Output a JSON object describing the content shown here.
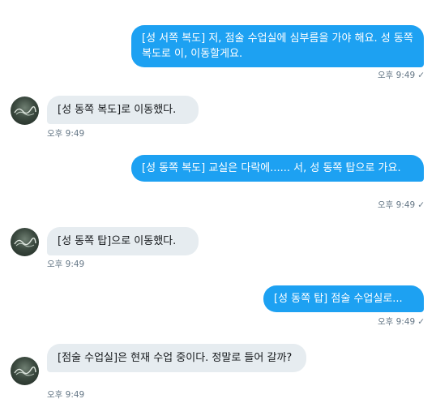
{
  "conversation": {
    "messages": [
      {
        "from": "me",
        "text": "[성 서쪽 복도] 저, 점술 수업실에 심부름을 가야 해요. 성 동쪽 복도로 이, 이동할게요.",
        "time": "오후 9:49",
        "status_icon": "check-icon"
      },
      {
        "from": "bot",
        "text": "[성 동쪽 복도]로 이동했다.",
        "time": "오후 9:49"
      },
      {
        "from": "me",
        "text": "[성 동쪽 복도] 교실은 다락에...... 서, 성 동쪽 탑으로 가요.",
        "time": "오후 9:49",
        "status_icon": "check-icon"
      },
      {
        "from": "bot",
        "text": "[성 동쪽 탑]으로 이동했다.",
        "time": "오후 9:49"
      },
      {
        "from": "me",
        "text": "[성 동쪽 탑] 점술 수업실로...",
        "time": "오후 9:49",
        "status_icon": "check-icon"
      },
      {
        "from": "bot",
        "text": "[점술 수업실]은 현재 수업 중이다. 정말로 들어 갈까?",
        "time": "오후 9:49"
      }
    ]
  },
  "theme": {
    "outgoing_bubble": "#1da1f2",
    "incoming_bubble": "#e6ecf0",
    "meta_text": "#657786"
  }
}
